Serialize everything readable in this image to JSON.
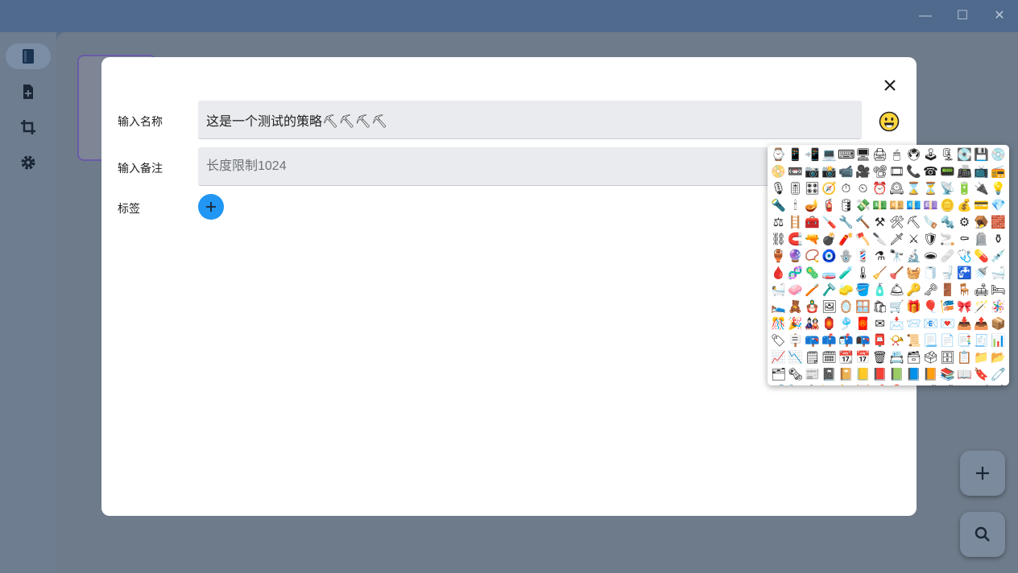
{
  "window": {
    "min_glyph": "—",
    "max_glyph": "☐",
    "close_glyph": "✕"
  },
  "sidebar": {
    "items": [
      {
        "icon": "book-icon",
        "active": true
      },
      {
        "icon": "add-file-icon",
        "active": false
      },
      {
        "icon": "crop-icon",
        "active": false
      },
      {
        "icon": "gear-icon",
        "active": false
      }
    ]
  },
  "dialog": {
    "name_label": "输入名称",
    "name_value": "这是一个测试的策略⛏⛏⛏⛏",
    "note_label": "输入备注",
    "note_placeholder": "长度限制1024",
    "tags_label": "标签"
  },
  "emoji_picker": {
    "symbols": "⌚📱📲💻⌨🖥🖨🖱🖲🕹🗜💽💾💿📀📼📷📸📹🎥📽🎞📞☎📟📠📺📻🎙🎚🎛🧭⏱⏲⏰🕰⌛⏳📡🔋🔌💡🔦🕯🪔🧯🛢💸💵💴💶💷🪙💰💳💎⚖🪜🧰🪛🔧🔨⚒🛠⛏🪚🔩⚙🪤🧱⛓🧲🔫💣🧨🪓🔪🗡⚔🛡🚬⚰🪦⚱🏺🔮📿🧿🪬💈⚗🔭🔬🕳🩹🩺💊💉🩸🧬🦠🧫🧪🌡🧹🪠🧺🧻🚽🚰🚿🛁🛀🧼🪥🪒🧽🪣🧴🛎🔑🗝🚪🪑🛋🛏🛌🧸🪆🖼🪞🪟🛍🛒🎁🎈🎏🎀🪄🪅🎊🎉🎎🏮🎐🧧✉📩📨📧💌📥📤📦🏷🪧📪📫📬📭📮📯📜📃📄📑🧾📊📈📉🗒🗓📆📅🗑📇🗃🗳🗄📋📁📂🗂🗞📰📓📔📒📕📗📘📙📚📖🔖🧷🔗📎🖇📐📏🧮📌📍✂🖊🖋✒🖌🖍📝✏🔍🔎🔏🔐🔒🔓"
  },
  "fabs": [
    {
      "name": "add"
    },
    {
      "name": "search"
    }
  ]
}
